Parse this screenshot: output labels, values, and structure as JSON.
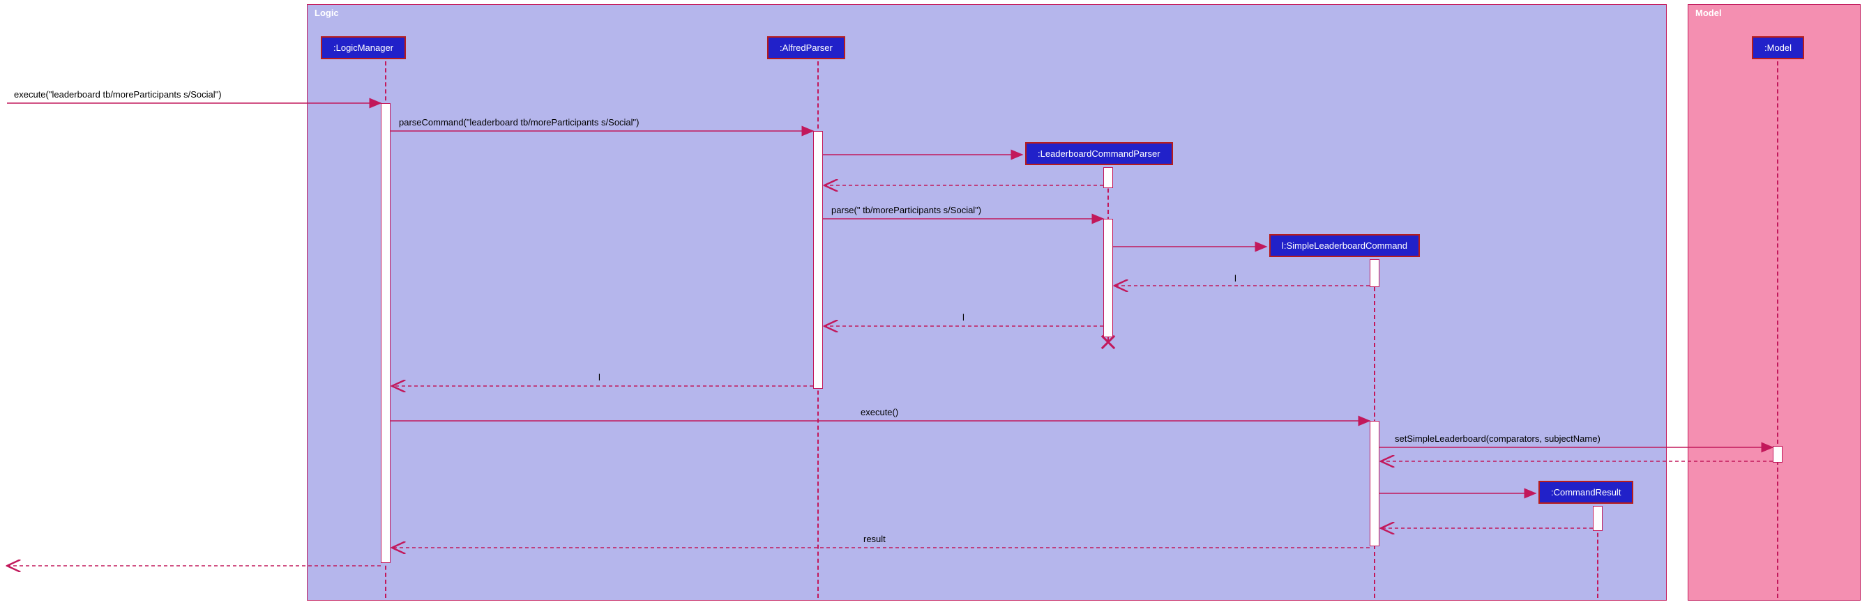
{
  "frames": {
    "logic": "Logic",
    "model": "Model"
  },
  "participants": {
    "logicManager": ":LogicManager",
    "alfredParser": ":AlfredParser",
    "lbParser": ":LeaderboardCommandParser",
    "simpleCmd": "l:SimpleLeaderboardCommand",
    "cmdResult": ":CommandResult",
    "model": ":Model"
  },
  "messages": {
    "execIn": "execute(\"leaderboard tb/moreParticipants s/Social\")",
    "parseCommand": "parseCommand(\"leaderboard tb/moreParticipants s/Social\")",
    "parse": "parse(\" tb/moreParticipants s/Social\")",
    "retL1": "l",
    "retL2": "l",
    "retL3": "l",
    "executeCmd": "execute()",
    "setSimple": "setSimpleLeaderboard(comparators, subjectName)",
    "result": "result"
  },
  "colors": {
    "line": "#c2185b",
    "participantBg": "#2121c9",
    "participantBorder": "#b71c1c",
    "logicBg": "#b5b6ec",
    "modelBg": "#f48fb1"
  }
}
